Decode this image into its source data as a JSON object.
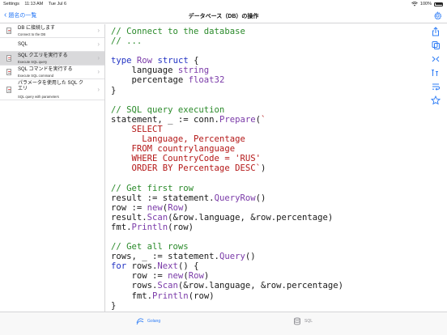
{
  "status_bar": {
    "carrier": "Settings",
    "time": "11:13 AM",
    "date": "Tue Jul 6",
    "battery": "100%"
  },
  "nav": {
    "back_label": "題名の一覧",
    "title": "データベース（DB）の操作"
  },
  "sidebar": {
    "items": [
      {
        "title": "DB に接続します",
        "subtitle": "Connect to the DB",
        "selected": false
      },
      {
        "title": "SQL",
        "subtitle": "",
        "selected": false
      },
      {
        "title": "SQL クエリを実行する",
        "subtitle": "Execute SQL query",
        "selected": true
      },
      {
        "title": "SQL コマンドを実行する",
        "subtitle": "Execute SQL command",
        "selected": false
      },
      {
        "title": "パラメータを使用した SQL クエリ",
        "subtitle": "SQL query with parameters",
        "selected": false
      }
    ]
  },
  "code": {
    "lines": [
      "// Connect to the database",
      "// ...",
      "",
      "type Row struct {",
      "    language string",
      "    percentage float32",
      "}",
      "",
      "// SQL query execution",
      "statement, _ := conn.Prepare(`",
      "    SELECT",
      "      Language, Percentage",
      "    FROM countrylanguage",
      "    WHERE CountryCode = 'RUS'",
      "    ORDER BY Percentage DESC`)",
      "",
      "// Get first row",
      "result := statement.QueryRow()",
      "row := new(Row)",
      "result.Scan(&row.language, &row.percentage)",
      "fmt.Println(row)",
      "",
      "// Get all rows",
      "rows, _ := statement.Query()",
      "for rows.Next() {",
      "    row := new(Row)",
      "    rows.Scan(&row.language, &row.percentage)",
      "    fmt.Println(row)",
      "}"
    ]
  },
  "tabs": [
    {
      "label": "Golang",
      "icon": "golang-tab-icon",
      "active": true
    },
    {
      "label": "SQL",
      "icon": "database-icon",
      "active": false
    }
  ],
  "colors": {
    "accent": "#2d7cf6",
    "comment": "#2a8a2a",
    "keyword": "#2233c4",
    "type": "#7a3aa8",
    "string": "#b41818",
    "selected_row": "#d9d9db"
  }
}
